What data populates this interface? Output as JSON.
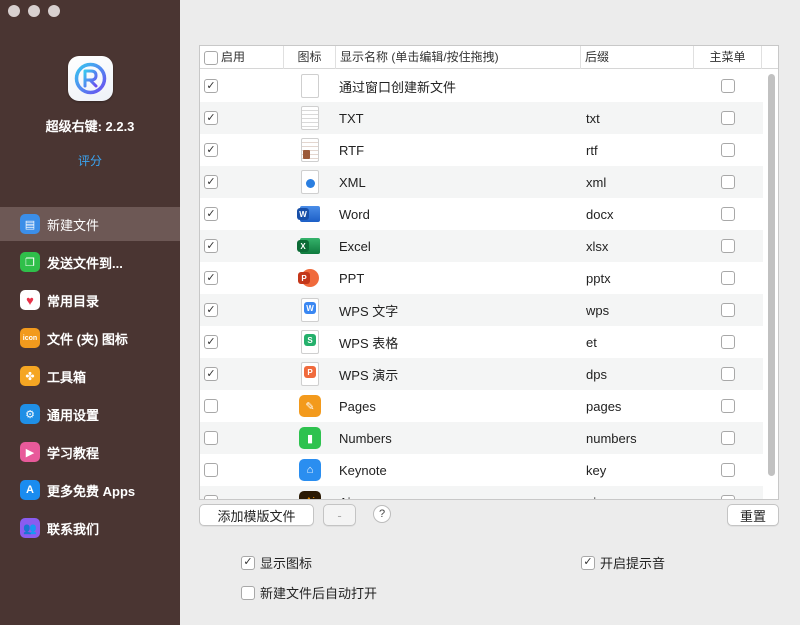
{
  "sidebar": {
    "app_version": "超级右键: 2.2.3",
    "rate_link": "评分",
    "items": [
      {
        "label": "新建文件",
        "icon": "new-file-icon",
        "color": "#3b8ee8",
        "glyph": "▤"
      },
      {
        "label": "发送文件到...",
        "icon": "send-file-icon",
        "color": "#2fbf4a",
        "glyph": "❐"
      },
      {
        "label": "常用目录",
        "icon": "heart-icon",
        "color": "#ffffff",
        "glyph": "♥"
      },
      {
        "label": "文件 (夹) 图标",
        "icon": "icon-badge-icon",
        "color": "#f29a1d",
        "glyph": "icon"
      },
      {
        "label": "工具箱",
        "icon": "toolbox-icon",
        "color": "#f5a623",
        "glyph": "✤"
      },
      {
        "label": "通用设置",
        "icon": "settings-icon",
        "color": "#1f8fe6",
        "glyph": "⚙"
      },
      {
        "label": "学习教程",
        "icon": "tutorial-icon",
        "color": "#e85a9a",
        "glyph": "▶"
      },
      {
        "label": "更多免费 Apps",
        "icon": "app-store-icon",
        "color": "#1a8cf0",
        "glyph": "A"
      },
      {
        "label": "联系我们",
        "icon": "contact-icon",
        "color": "#8a5cf0",
        "glyph": "👥"
      }
    ]
  },
  "table": {
    "headers": {
      "enable": "启用",
      "icon": "图标",
      "name": "显示名称 (单击编辑/按住拖拽)",
      "suffix": "后缀",
      "main_menu": "主菜单"
    },
    "rows": [
      {
        "enabled": true,
        "icon": "blank-doc-icon",
        "name": "通过窗口创建新文件",
        "suffix": "",
        "main_menu": false
      },
      {
        "enabled": true,
        "icon": "txt-doc-icon",
        "name": "TXT",
        "suffix": "txt",
        "main_menu": false
      },
      {
        "enabled": true,
        "icon": "rtf-doc-icon",
        "name": "RTF",
        "suffix": "rtf",
        "main_menu": false
      },
      {
        "enabled": true,
        "icon": "xml-doc-icon",
        "name": "XML",
        "suffix": "xml",
        "main_menu": false
      },
      {
        "enabled": true,
        "icon": "word-icon",
        "name": "Word",
        "suffix": "docx",
        "main_menu": false
      },
      {
        "enabled": true,
        "icon": "excel-icon",
        "name": "Excel",
        "suffix": "xlsx",
        "main_menu": false
      },
      {
        "enabled": true,
        "icon": "powerpoint-icon",
        "name": "PPT",
        "suffix": "pptx",
        "main_menu": false
      },
      {
        "enabled": true,
        "icon": "wps-writer-icon",
        "name": "WPS 文字",
        "suffix": "wps",
        "main_menu": false
      },
      {
        "enabled": true,
        "icon": "wps-sheet-icon",
        "name": "WPS 表格",
        "suffix": "et",
        "main_menu": false
      },
      {
        "enabled": true,
        "icon": "wps-present-icon",
        "name": "WPS 演示",
        "suffix": "dps",
        "main_menu": false
      },
      {
        "enabled": false,
        "icon": "pages-icon",
        "name": "Pages",
        "suffix": "pages",
        "main_menu": false
      },
      {
        "enabled": false,
        "icon": "numbers-icon",
        "name": "Numbers",
        "suffix": "numbers",
        "main_menu": false
      },
      {
        "enabled": false,
        "icon": "keynote-icon",
        "name": "Keynote",
        "suffix": "key",
        "main_menu": false
      },
      {
        "enabled": false,
        "icon": "illustrator-icon",
        "name": "Ai",
        "suffix": "ai",
        "main_menu": false
      }
    ]
  },
  "buttons": {
    "add_template": "添加模版文件",
    "remove": "-",
    "help": "?",
    "reset": "重置"
  },
  "options": {
    "show_icon": {
      "label": "显示图标",
      "checked": true
    },
    "play_sound": {
      "label": "开启提示音",
      "checked": true
    },
    "auto_open": {
      "label": "新建文件后自动打开",
      "checked": false
    }
  }
}
